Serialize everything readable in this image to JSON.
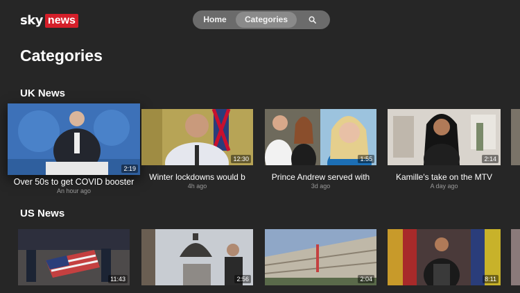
{
  "brand": {
    "sky": "sky",
    "news": "news",
    "accent": "#d51f2a"
  },
  "nav": {
    "home": "Home",
    "categories": "Categories",
    "search_icon": "search-icon"
  },
  "page_title": "Categories",
  "sections": [
    {
      "title": "UK News",
      "cards": [
        {
          "title": "Over 50s to get COVID booster",
          "subtitle": "An hour ago",
          "duration": "2:19",
          "focused": true
        },
        {
          "title": "Winter lockdowns would b",
          "subtitle": "4h ago",
          "duration": "12:30"
        },
        {
          "title": "Prince Andrew served with",
          "subtitle": "3d ago",
          "duration": "1:55"
        },
        {
          "title": "Kamille's take on the MTV",
          "subtitle": "A day ago",
          "duration": "2:14"
        }
      ]
    },
    {
      "title": "US News",
      "cards": [
        {
          "duration": "11:43"
        },
        {
          "duration": "2:56"
        },
        {
          "duration": "2:04"
        },
        {
          "duration": "8:11"
        }
      ]
    }
  ]
}
